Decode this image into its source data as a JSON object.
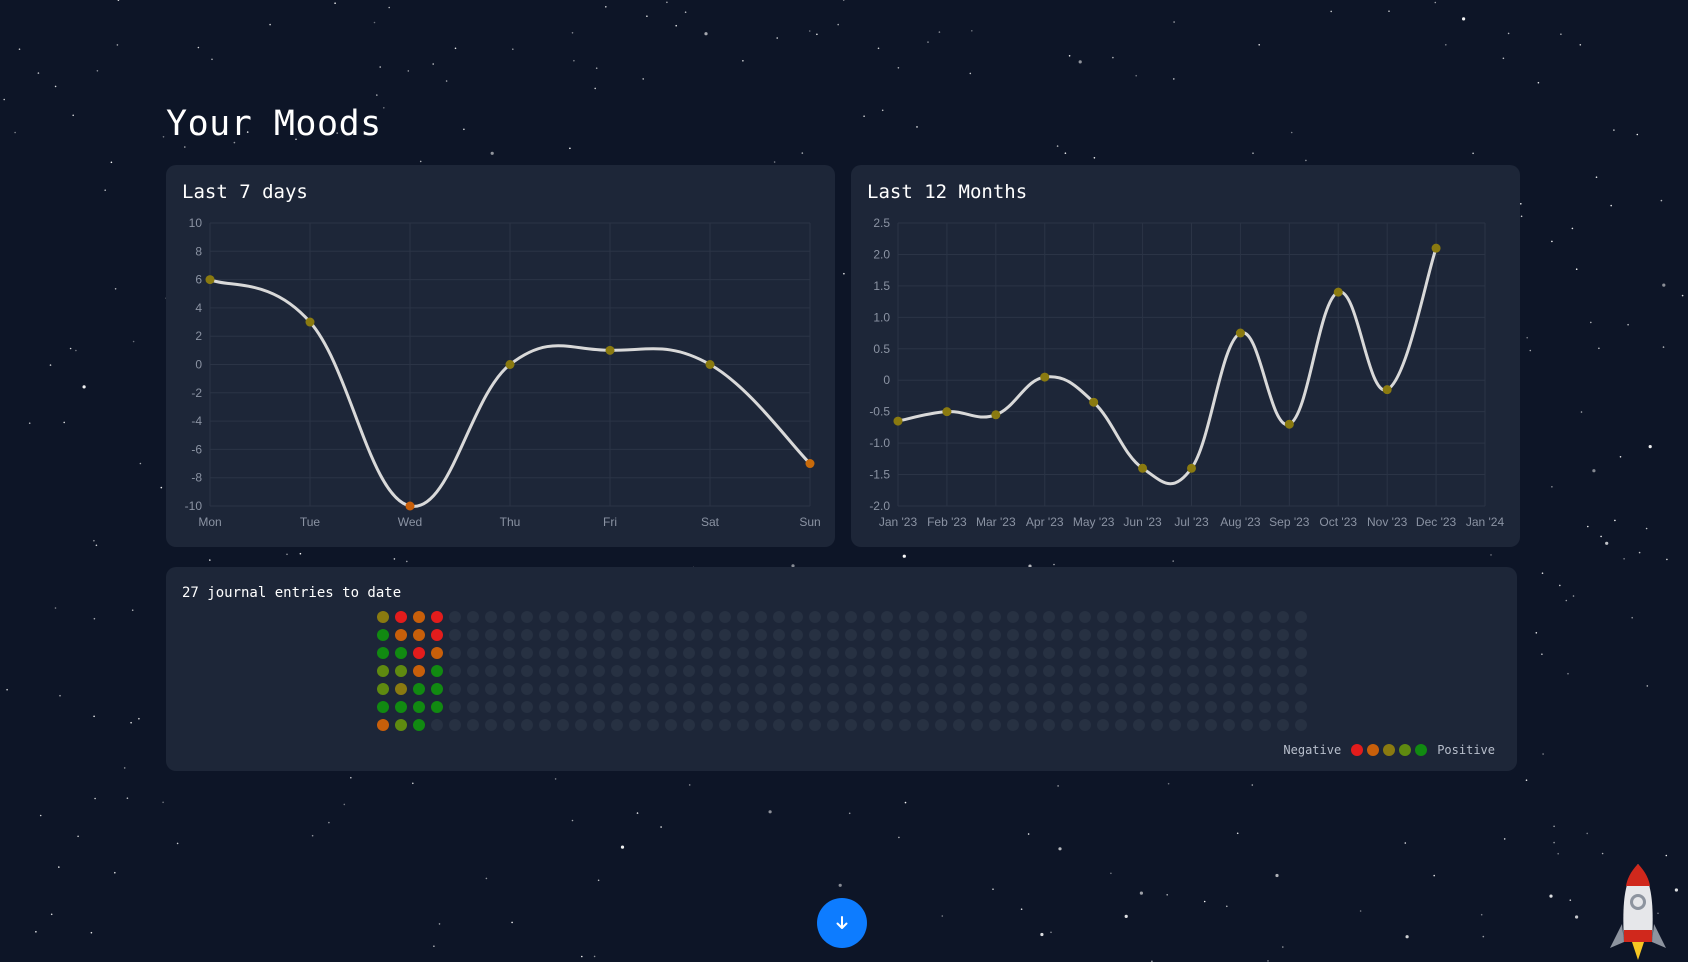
{
  "page": {
    "title": "Your Moods"
  },
  "weekly": {
    "title": "Last 7 days",
    "chart_data": {
      "type": "line",
      "categories": [
        "Mon",
        "Tue",
        "Wed",
        "Thu",
        "Fri",
        "Sat",
        "Sun"
      ],
      "values": [
        6,
        3,
        -10,
        0,
        1,
        0,
        -7
      ],
      "ylim": [
        -10,
        10
      ],
      "yticks": [
        10,
        8,
        6,
        4,
        2,
        0,
        -2,
        -4,
        -6,
        -8,
        -10
      ],
      "ytick_labels": [
        "10",
        "8",
        "6",
        "4",
        "2",
        "0",
        "-2",
        "-4",
        "-6",
        "-8",
        "-10"
      ],
      "grid": true,
      "point_colors": [
        "#8a7a10",
        "#8a7a10",
        "#c85f0a",
        "#8a7a10",
        "#8a7a10",
        "#8a7a10",
        "#c86a0a"
      ],
      "line_color": "#d9d9d9"
    }
  },
  "monthly": {
    "title": "Last 12 Months",
    "chart_data": {
      "type": "line",
      "categories": [
        "Jan '23",
        "Feb '23",
        "Mar '23",
        "Apr '23",
        "May '23",
        "Jun '23",
        "Jul '23",
        "Aug '23",
        "Sep '23",
        "Oct '23",
        "Nov '23",
        "Dec '23",
        "Jan '24"
      ],
      "values": [
        -0.65,
        -0.5,
        -0.55,
        0.05,
        -0.35,
        -1.4,
        -1.4,
        0.75,
        -0.7,
        1.4,
        -0.15,
        2.1
      ],
      "ylim": [
        -2.0,
        2.5
      ],
      "yticks": [
        2.5,
        2.0,
        1.5,
        1.0,
        0.5,
        0,
        -0.5,
        -1.0,
        -1.5,
        -2.0
      ],
      "ytick_labels": [
        "2.5",
        "2.0",
        "1.5",
        "1.0",
        "0.5",
        "0",
        "-0.5",
        "-1.0",
        "-1.5",
        "-2.0"
      ],
      "grid": true,
      "point_colors": [
        "#8a7a10",
        "#8a7a10",
        "#8a7a10",
        "#8a7a10",
        "#8a7a10",
        "#8a7a10",
        "#8a7a10",
        "#8a7a10",
        "#8a7a10",
        "#8a7a10",
        "#8a7a10",
        "#8a7a10"
      ],
      "line_color": "#d9d9d9"
    }
  },
  "journal": {
    "title": "27 journal entries to date",
    "grid_columns": 52,
    "grid_rows": 7,
    "entries": [
      [
        "#8a7a10",
        "#e31c1c",
        "#c85f0a",
        "#e31c1c"
      ],
      [
        "#118a11",
        "#c85f0a",
        "#c85f0a",
        "#e31c1c"
      ],
      [
        "#118a11",
        "#118a11",
        "#e31c1c",
        "#c85f0a"
      ],
      [
        "#5f8a10",
        "#5f8a10",
        "#c85f0a",
        "#118a11"
      ],
      [
        "#5f8a10",
        "#8a7a10",
        "#118a11",
        "#118a11"
      ],
      [
        "#118a11",
        "#118a11",
        "#118a11",
        "#118a11"
      ],
      [
        "#c85f0a",
        "#5f8a10",
        "#118a11"
      ]
    ],
    "empty_color": "#273142",
    "legend": {
      "negative_label": "Negative",
      "positive_label": "Positive",
      "scale_colors": [
        "#e31c1c",
        "#c85f0a",
        "#8a7a10",
        "#5f8a10",
        "#118a11"
      ]
    }
  },
  "scroll_button": {
    "icon": "arrow-down-icon",
    "color": "#0d7cff"
  },
  "rocket": {
    "icon": "rocket-icon"
  }
}
